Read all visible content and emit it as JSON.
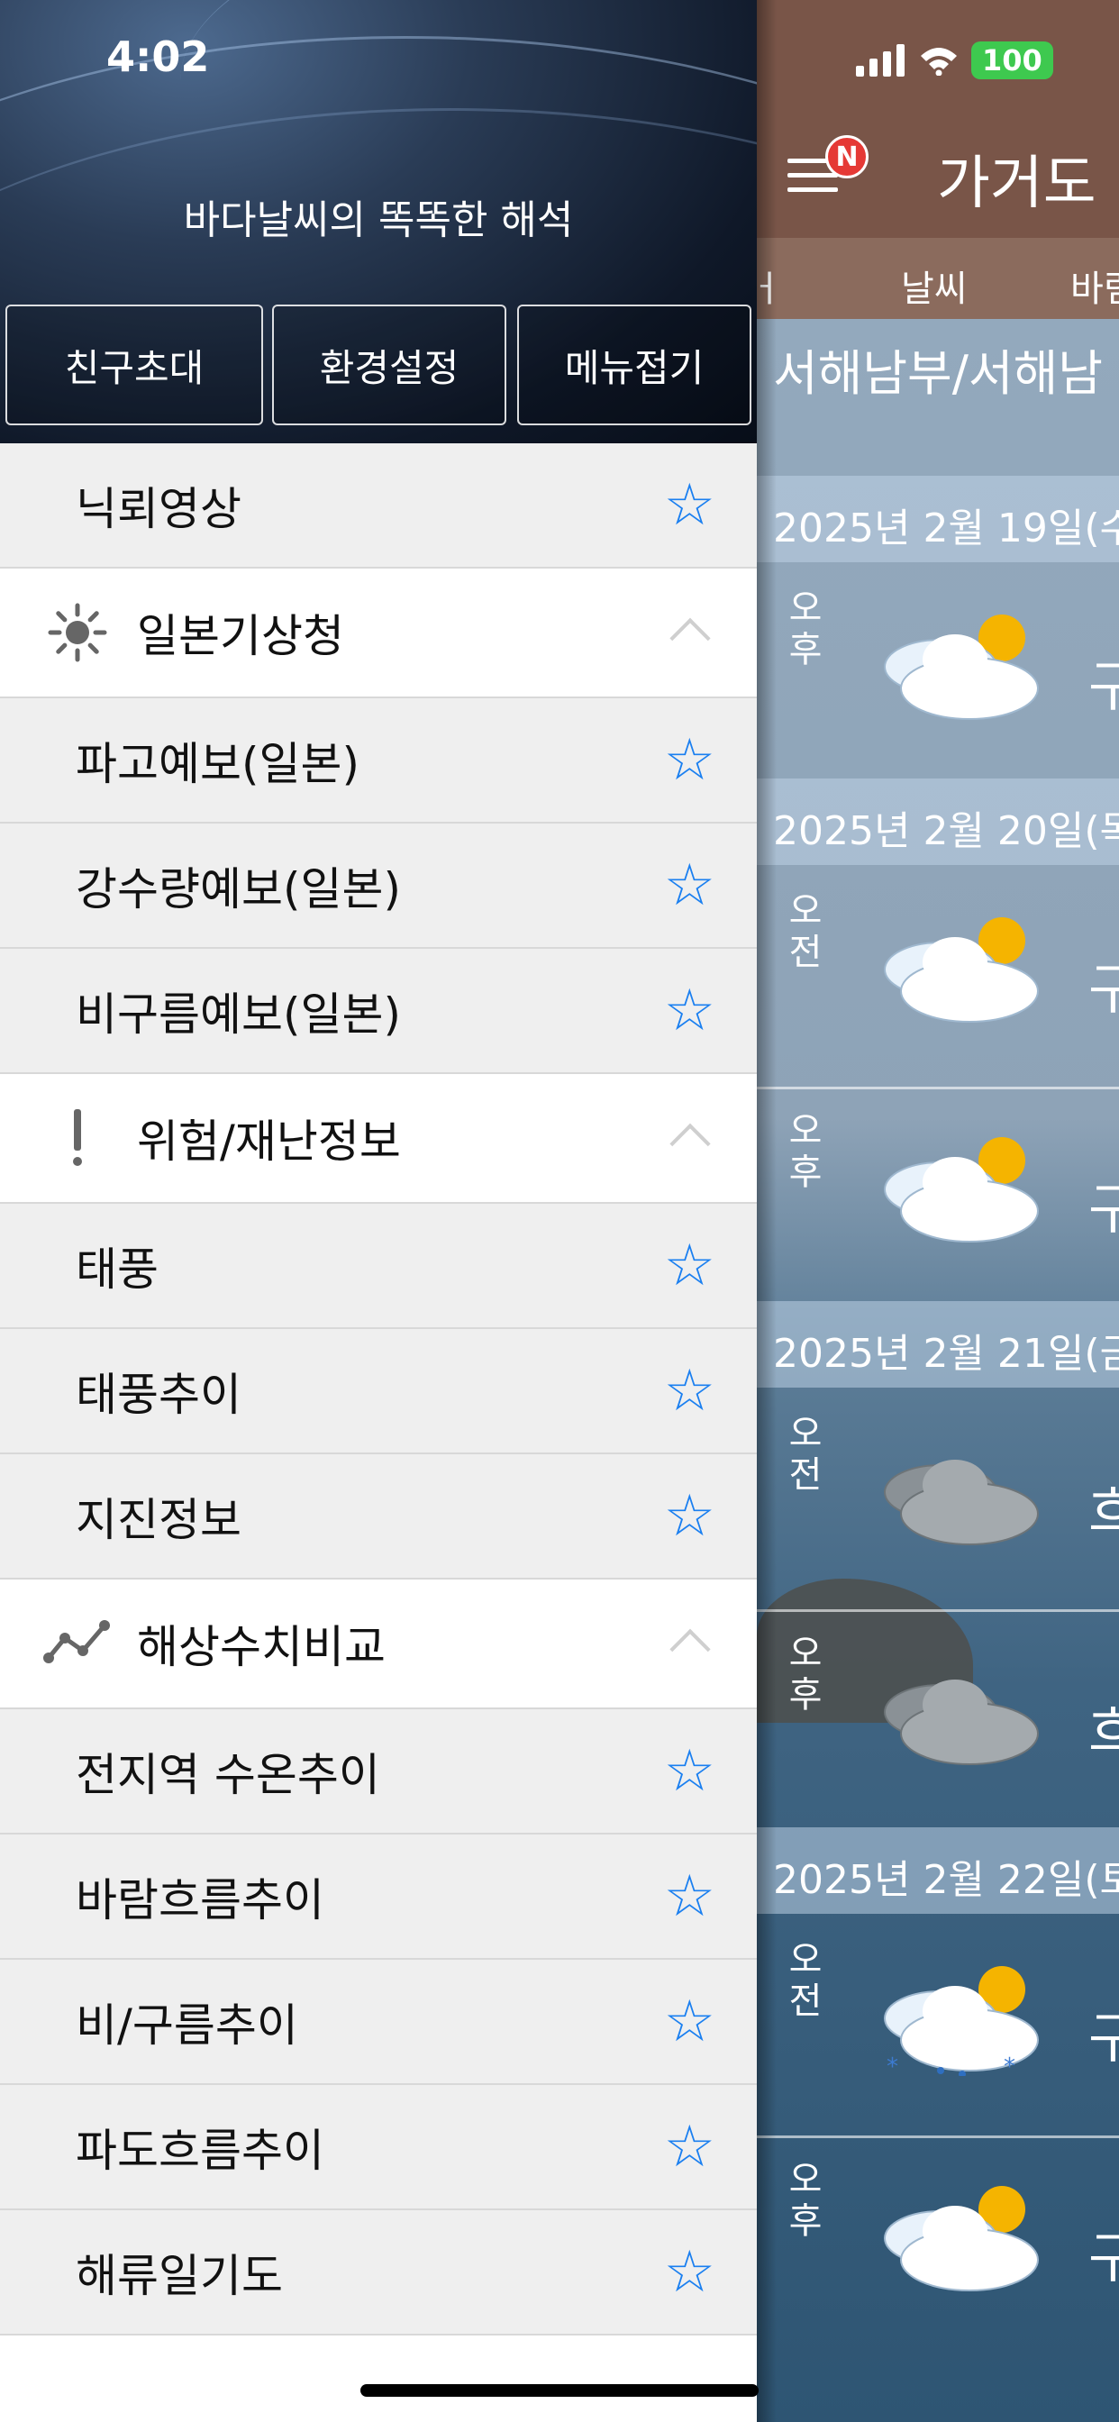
{
  "status_bar": {
    "time": "4:02",
    "battery": "100"
  },
  "drawer": {
    "tagline": "바다날씨의 똑똑한 해석",
    "buttons": [
      "친구초대",
      "환경설정",
      "메뉴접기"
    ],
    "rows": [
      {
        "kind": "item",
        "label": "닉뢰영상"
      },
      {
        "kind": "section",
        "label": "일본기상청",
        "icon": "sun-icon"
      },
      {
        "kind": "item",
        "label": "파고예보(일본)"
      },
      {
        "kind": "item",
        "label": "강수량예보(일본)"
      },
      {
        "kind": "item",
        "label": "비구름예보(일본)"
      },
      {
        "kind": "section",
        "label": "위험/재난정보",
        "icon": "exclamation-icon"
      },
      {
        "kind": "item",
        "label": "태풍"
      },
      {
        "kind": "item",
        "label": "태풍추이"
      },
      {
        "kind": "item",
        "label": "지진정보"
      },
      {
        "kind": "section",
        "label": "해상수치비교",
        "icon": "line-chart-icon"
      },
      {
        "kind": "item",
        "label": "전지역 수온추이"
      },
      {
        "kind": "item",
        "label": "바람흐름추이"
      },
      {
        "kind": "item",
        "label": "비/구름추이"
      },
      {
        "kind": "item",
        "label": "파도흐름추이"
      },
      {
        "kind": "item",
        "label": "해류일기도"
      }
    ],
    "star_glyph": "☆"
  },
  "app": {
    "badge": "N",
    "title": "가거도",
    "tabs": [
      "ㅓ",
      "날씨",
      "바림"
    ],
    "region": "서해남부/서해남",
    "days": [
      {
        "date": "2025년 2월 19일(수",
        "forecasts": [
          {
            "ampm": "오후",
            "cond": "구",
            "icon": "partly-cloudy-icon"
          }
        ]
      },
      {
        "date": "2025년 2월 20일(목",
        "forecasts": [
          {
            "ampm": "오전",
            "cond": "구",
            "icon": "partly-cloudy-icon"
          },
          {
            "ampm": "오후",
            "cond": "구",
            "icon": "partly-cloudy-icon"
          }
        ]
      },
      {
        "date": "2025년 2월 21일(금",
        "forecasts": [
          {
            "ampm": "오전",
            "cond": "흐",
            "icon": "cloudy-icon"
          },
          {
            "ampm": "오후",
            "cond": "흐",
            "icon": "cloudy-icon"
          }
        ]
      },
      {
        "date": "2025년 2월 22일(토",
        "forecasts": [
          {
            "ampm": "오전",
            "cond": "구",
            "icon": "rain-snow-icon"
          },
          {
            "ampm": "오후",
            "cond": "구",
            "icon": "partly-cloudy-icon"
          }
        ]
      }
    ]
  },
  "colors": {
    "star": "#1a7ff0",
    "topbar": "#795548",
    "tabs": "#8b6b5d",
    "badge": "#e53935",
    "battery": "#3ec94f"
  }
}
